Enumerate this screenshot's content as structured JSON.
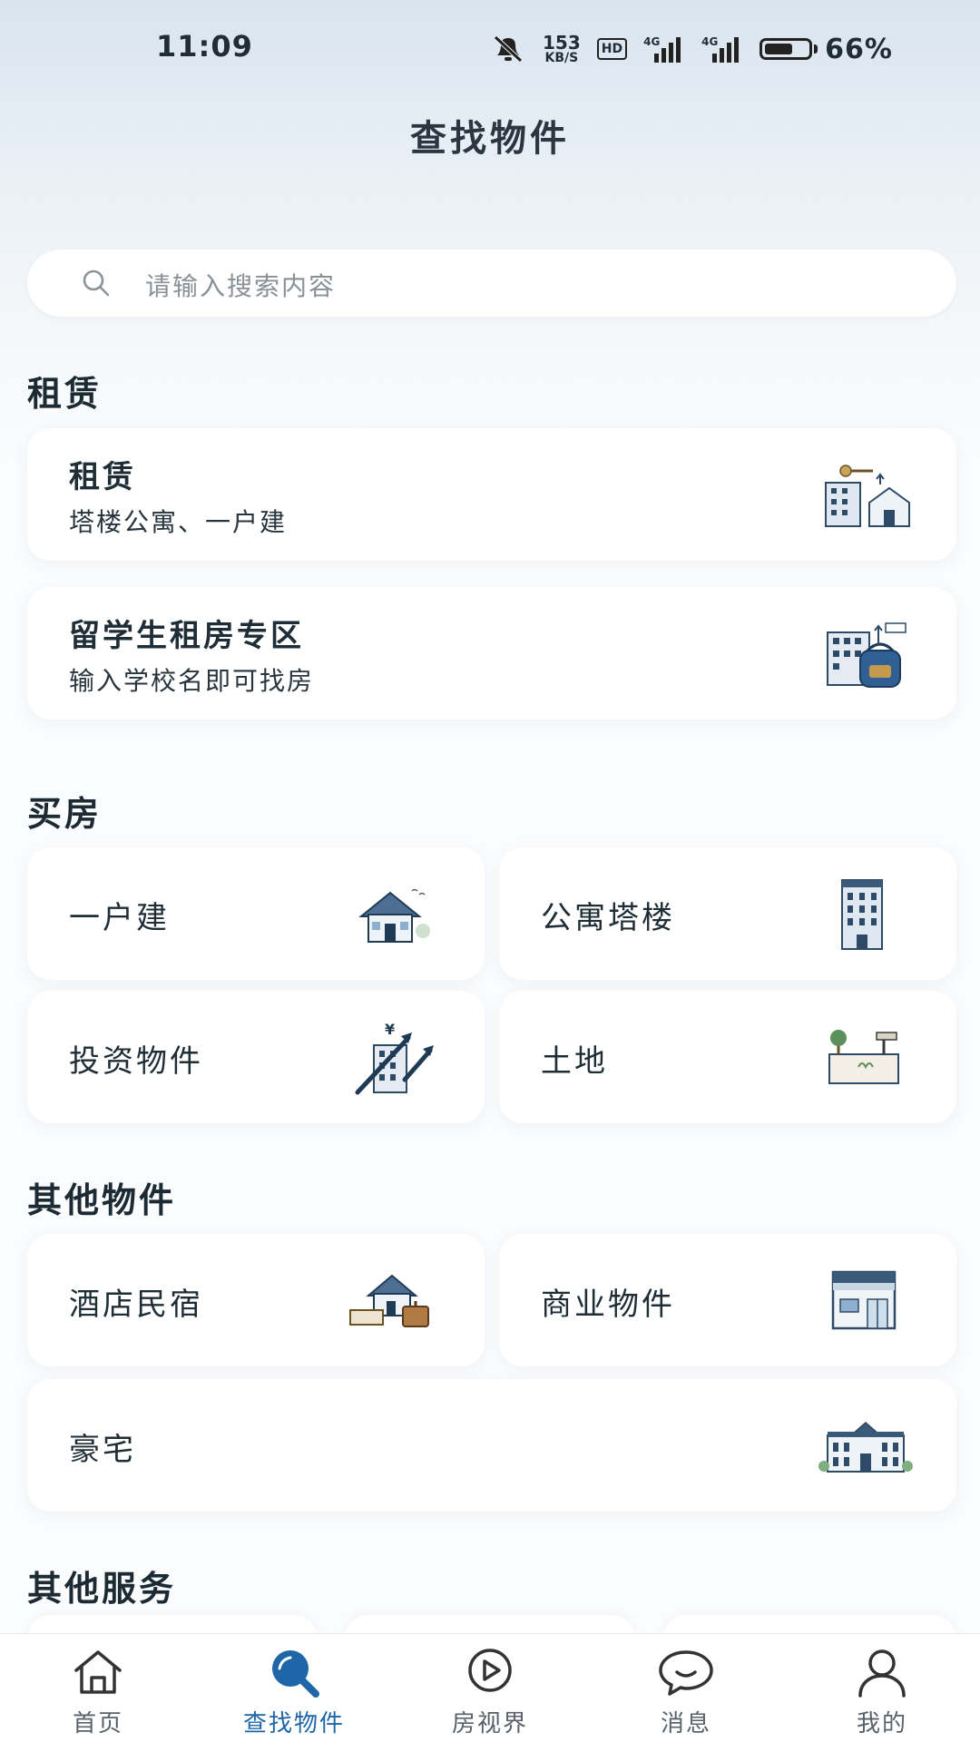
{
  "status_bar": {
    "time": "11:09",
    "net_speed": "153",
    "net_unit": "KB/S",
    "hd": "HD",
    "sig1": "4G",
    "sig2": "4G",
    "battery": "66%",
    "battery_level": 0.66
  },
  "page": {
    "title": "查找物件"
  },
  "search": {
    "placeholder": "请输入搜索内容"
  },
  "sections": {
    "rent": {
      "title": "租赁",
      "cards": [
        {
          "title": "租赁",
          "subtitle": "塔楼公寓、一户建",
          "icon": "rent-building-key-icon"
        },
        {
          "title": "留学生租房专区",
          "subtitle": "输入学校名即可找房",
          "icon": "student-backpack-building-icon"
        }
      ]
    },
    "buy": {
      "title": "买房",
      "cards": [
        {
          "title": "一户建",
          "icon": "detached-house-icon"
        },
        {
          "title": "公寓塔楼",
          "icon": "apartment-tower-icon"
        },
        {
          "title": "投资物件",
          "icon": "investment-building-icon"
        },
        {
          "title": "土地",
          "icon": "land-plot-icon"
        }
      ]
    },
    "other": {
      "title": "其他物件",
      "cards": [
        {
          "title": "酒店民宿",
          "icon": "hotel-house-icon"
        },
        {
          "title": "商业物件",
          "icon": "commercial-store-icon"
        },
        {
          "title": "豪宅",
          "icon": "mansion-icon"
        }
      ]
    },
    "services": {
      "title": "其他服务"
    }
  },
  "tabbar": {
    "active_color": "#1f66a8",
    "tabs": [
      {
        "label": "首页",
        "icon": "home-icon"
      },
      {
        "label": "查找物件",
        "icon": "search-icon"
      },
      {
        "label": "房视界",
        "icon": "play-icon"
      },
      {
        "label": "消息",
        "icon": "chat-bubble-icon"
      },
      {
        "label": "我的",
        "icon": "user-icon"
      }
    ]
  }
}
